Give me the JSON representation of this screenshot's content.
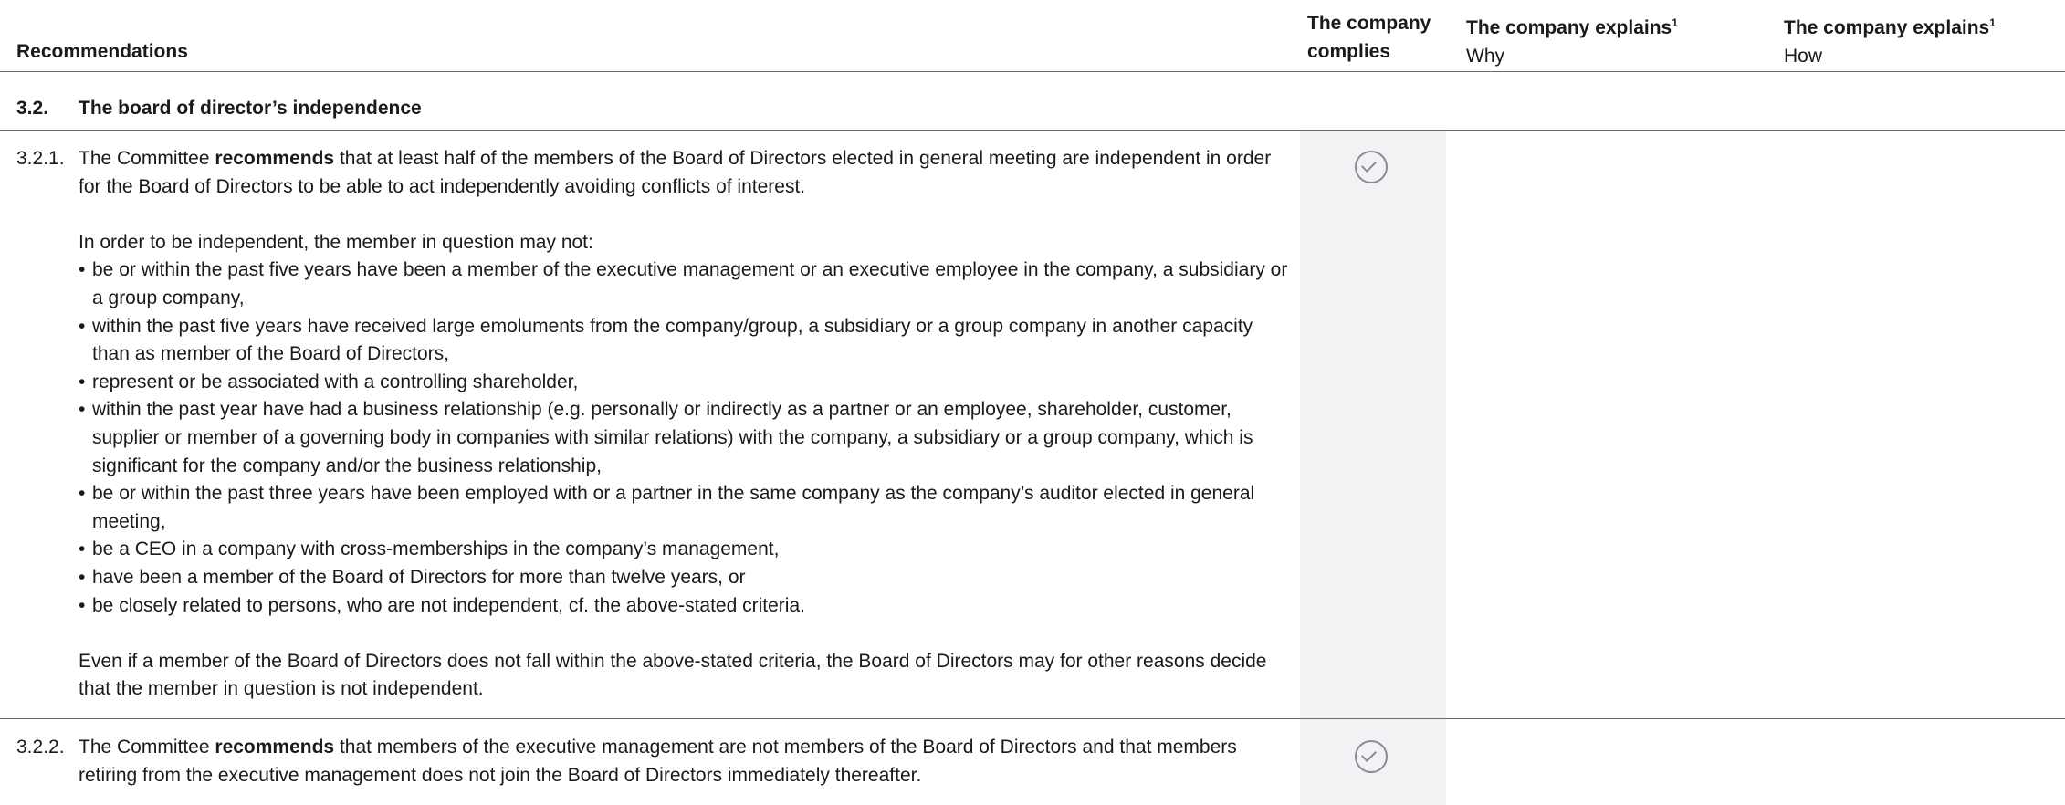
{
  "header": {
    "recommendations": "Recommendations",
    "complies_line1": "The company",
    "complies_line2": "complies",
    "explains_why_title": "The company explains",
    "explains_why_sup": "1",
    "explains_why_sub": "Why",
    "explains_how_title": "The company explains",
    "explains_how_sup": "1",
    "explains_how_sub": "How"
  },
  "section": {
    "number": "3.2.",
    "title": "The board of director’s independence"
  },
  "rows": [
    {
      "number": "3.2.1.",
      "intro_before": "The Committee ",
      "intro_bold": "recommends",
      "intro_after": " that at least half of the members of the Board of Directors elected in general meeting are independent in order for the Board of Directors to be able to act independently avoiding conflicts of interest.",
      "lead": "In order to be independent, the member in question may not:",
      "bullets": [
        "be or within the past five years have been a member of the executive management or an executive employee in the company, a subsidiary or a group company,",
        "within the past five years have received large emoluments from the company/group, a subsidiary or a group company in another capacity than as member of the Board of Directors,",
        "represent or be associated with a controlling shareholder,",
        "within the past year have had a business relationship (e.g. personally or indirectly as a partner or an employee, shareholder, customer, supplier or member of a governing body in companies with similar relations) with the company, a subsidiary or a group company, which is significant for the company and/or the business relationship,",
        "be or within the past three years have been employed with or a partner in the same company as the company’s auditor elected in general meeting,",
        "be a CEO in a company with cross-memberships in the company’s management,",
        "have been a member of the Board of Directors for more than twelve years, or",
        "be closely related to persons, who are not independent, cf. the above-stated criteria."
      ],
      "closing": "Even if a member of the Board of Directors does not fall within the above-stated criteria, the Board of Directors may for other reasons decide that the member in question is not independent.",
      "complies_icon": "check-circle-icon"
    },
    {
      "number": "3.2.2.",
      "intro_before": "The Committee ",
      "intro_bold": "recommends",
      "intro_after": " that members of the executive management are not members of the Board of Directors and that members retiring from the executive management does not join the Board of Directors immediately thereafter.",
      "complies_icon": "check-circle-icon"
    }
  ],
  "colors": {
    "complies_band": "#f2f2f4",
    "check_icon": "#8a8a92",
    "rule": "#6b6b6b"
  }
}
